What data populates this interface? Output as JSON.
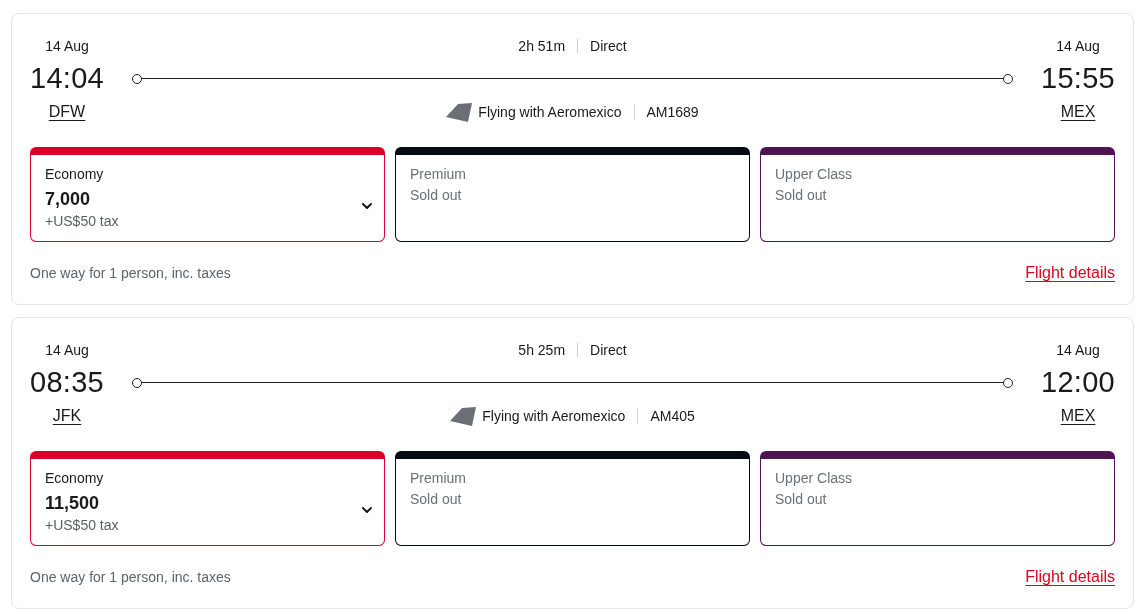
{
  "flights": [
    {
      "departure": {
        "date": "14 Aug",
        "time": "14:04",
        "airport": "DFW"
      },
      "duration": "2h 51m",
      "stops": "Direct",
      "carrier": "Flying with Aeromexico",
      "flight_number": "AM1689",
      "arrival": {
        "date": "14 Aug",
        "time": "15:55",
        "airport": "MEX"
      },
      "fares": [
        {
          "kind": "available",
          "cabin": "Economy",
          "price": "7,000",
          "tax": "+US$50 tax",
          "color": "#d9002b"
        },
        {
          "kind": "sold_out",
          "cabin": "Premium",
          "status": "Sold out",
          "color": "#050a14"
        },
        {
          "kind": "sold_out",
          "cabin": "Upper Class",
          "status": "Sold out",
          "color": "#4f1454"
        }
      ],
      "note": "One way for 1 person, inc. taxes",
      "details_link": "Flight details"
    },
    {
      "departure": {
        "date": "14 Aug",
        "time": "08:35",
        "airport": "JFK"
      },
      "duration": "5h 25m",
      "stops": "Direct",
      "carrier": "Flying with Aeromexico",
      "flight_number": "AM405",
      "arrival": {
        "date": "14 Aug",
        "time": "12:00",
        "airport": "MEX"
      },
      "fares": [
        {
          "kind": "available",
          "cabin": "Economy",
          "price": "11,500",
          "tax": "+US$50 tax",
          "color": "#d9002b"
        },
        {
          "kind": "sold_out",
          "cabin": "Premium",
          "status": "Sold out",
          "color": "#050a14"
        },
        {
          "kind": "sold_out",
          "cabin": "Upper Class",
          "status": "Sold out",
          "color": "#4f1454"
        }
      ],
      "note": "One way for 1 person, inc. taxes",
      "details_link": "Flight details"
    }
  ]
}
